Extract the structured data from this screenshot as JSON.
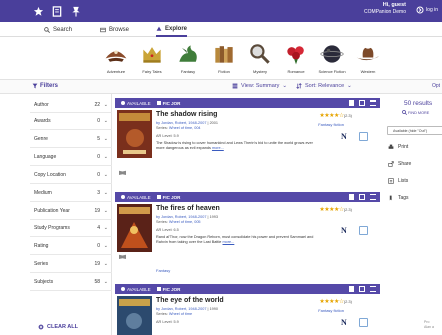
{
  "topbar": {
    "icons": [
      "star-badge-icon",
      "bookmark-icon",
      "pin-icon"
    ],
    "user_greeting": "Hi, guest",
    "user_org": "COMPanion Demo",
    "logout_label": "log in"
  },
  "tabs": [
    {
      "label": "Search",
      "icon": "search-icon",
      "active": false
    },
    {
      "label": "Browse",
      "icon": "browse-icon",
      "active": false
    },
    {
      "label": "Explore",
      "icon": "explore-icon",
      "active": true
    }
  ],
  "genres": [
    {
      "label": "Adventure",
      "icon": "pirate-hat-icon",
      "color": "#8a4b2a"
    },
    {
      "label": "Fairy Tales",
      "icon": "crown-icon",
      "color": "#caa437"
    },
    {
      "label": "Fantasy",
      "icon": "dragon-icon",
      "color": "#3f7d3a"
    },
    {
      "label": "Fiction",
      "icon": "books-icon",
      "color": "#b8893c"
    },
    {
      "label": "Mystery",
      "icon": "magnifier-icon",
      "color": "#5a4a3a"
    },
    {
      "label": "Romance",
      "icon": "roses-icon",
      "color": "#c21f2c"
    },
    {
      "label": "Science Fiction",
      "icon": "planet-icon",
      "color": "#2a2a3a"
    },
    {
      "label": "Western",
      "icon": "cowboy-hat-icon",
      "color": "#6b3e22"
    }
  ],
  "filter_bar": {
    "filters_label": "Filters",
    "view_label": "View: Summary",
    "sort_label": "Sort: Relevance",
    "options_label": "Opt"
  },
  "filters": [
    {
      "label": "Author",
      "count": "22"
    },
    {
      "label": "Awards",
      "count": "0"
    },
    {
      "label": "Genre",
      "count": "5"
    },
    {
      "label": "Language",
      "count": "0"
    },
    {
      "label": "Copy Location",
      "count": "0"
    },
    {
      "label": "Medium",
      "count": "3"
    },
    {
      "label": "Publication Year",
      "count": "19"
    },
    {
      "label": "Study Programs",
      "count": "4"
    },
    {
      "label": "Rating",
      "count": "0"
    },
    {
      "label": "Series",
      "count": "19"
    },
    {
      "label": "Subjects",
      "count": "58"
    }
  ],
  "clear_all_label": "CLEAR ALL",
  "results": [
    {
      "available": "AVAILABLE",
      "shelf": "FIC JOR",
      "title": "The shadow rising",
      "author_line": "by Jordan, Robert, 1948-2007",
      "year": "2001",
      "series_label": "Series:",
      "series": "Wheel of time, 004",
      "ar_level": "AR Level: 5.9",
      "description": "The Shadow is rising to cover humankind and Lews Therin's bid to unite the world grows ever more dangerous as evil expands",
      "more": "more...",
      "genre": "Fantasy fiction",
      "stars": "★★★★☆",
      "rating_count": "(2.3)",
      "cover_color": "#7a2f1c"
    },
    {
      "available": "AVAILABLE",
      "shelf": "FIC JOR",
      "title": "The fires of heaven",
      "author_line": "by Jordan, Robert, 1948-2007",
      "year": "1993",
      "series_label": "Series:",
      "series": "Wheel of time, 005",
      "ar_level": "AR Level: 6.5",
      "description": "Rand al'Thor, now the Dragon Reborn, must consolidate his power and prevent Sammael and Rahvin from taking over the Last Battle",
      "more": "more...",
      "genre": "Fantasy",
      "stars": "★★★★☆",
      "rating_count": "(2.3)",
      "cover_color": "#5a2218"
    },
    {
      "available": "AVAILABLE",
      "shelf": "FIC JOR",
      "title": "The eye of the world",
      "author_line": "by Jordan, Robert, 1948-2007",
      "year": "1990",
      "series_label": "Series:",
      "series": "Wheel of time",
      "ar_level": "AR Level: 5.9",
      "description": "",
      "more": "",
      "genre": "Fantasy fiction",
      "stars": "★★★★☆",
      "rating_count": "(2.3)",
      "cover_color": "#2c4a6e"
    }
  ],
  "right_panel": {
    "results_count": "50 results",
    "find_more": "FIND MORE",
    "availability_select": "Available (hide \"Out\")",
    "actions": [
      {
        "label": "Print",
        "icon": "print-icon"
      },
      {
        "label": "Share",
        "icon": "share-icon"
      },
      {
        "label": "Lists",
        "icon": "lists-icon"
      },
      {
        "label": "Tags",
        "icon": "tags-icon"
      }
    ],
    "pro_label": "Pro",
    "pro_sub": "Alan a"
  }
}
